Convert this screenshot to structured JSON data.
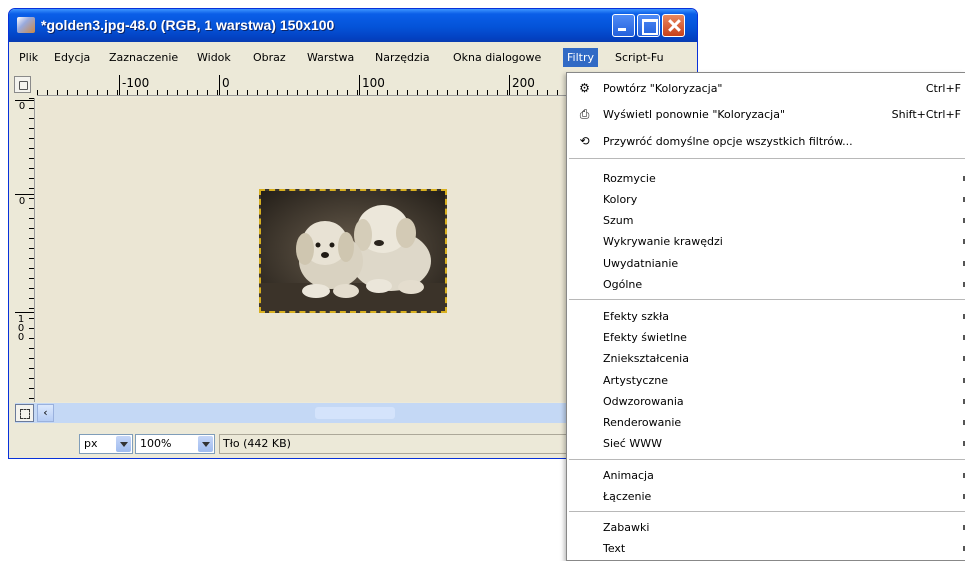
{
  "window": {
    "title": "*golden3.jpg-48.0 (RGB, 1 warstwa) 150x100"
  },
  "menubar": [
    "Plik",
    "Edycja",
    "Zaznaczenie",
    "Widok",
    "Obraz",
    "Warstwa",
    "Narzędzia",
    "Okna dialogowe",
    "Filtry",
    "Script-Fu"
  ],
  "ruler": {
    "h_labels": [
      "-100",
      "0",
      "100",
      "200"
    ],
    "v_labels": [
      "0",
      "0",
      "100"
    ]
  },
  "status": {
    "unit": "px",
    "zoom": "100%",
    "layer_info": "Tło (442 KB)"
  },
  "filters_menu": {
    "top_items": [
      {
        "label": "Powtórz \"Koloryzacja\"",
        "shortcut": "Ctrl+F",
        "icon": "gear-icon"
      },
      {
        "label": "Wyświetl ponownie \"Koloryzacja\"",
        "shortcut": "Shift+Ctrl+F",
        "icon": "reshow-icon"
      },
      {
        "label": "Przywróć domyślne opcje wszystkich filtrów...",
        "shortcut": "",
        "icon": "reset-icon"
      }
    ],
    "group1": [
      "Rozmycie",
      "Kolory",
      "Szum",
      "Wykrywanie krawędzi",
      "Uwydatnianie",
      "Ogólne"
    ],
    "group2": [
      "Efekty szkła",
      "Efekty świetlne",
      "Zniekształcenia",
      "Artystyczne",
      "Odwzorowania",
      "Renderowanie",
      "Sieć WWW"
    ],
    "group3": [
      "Animacja",
      "Łączenie"
    ],
    "group4": [
      "Zabawki",
      "Text"
    ]
  }
}
